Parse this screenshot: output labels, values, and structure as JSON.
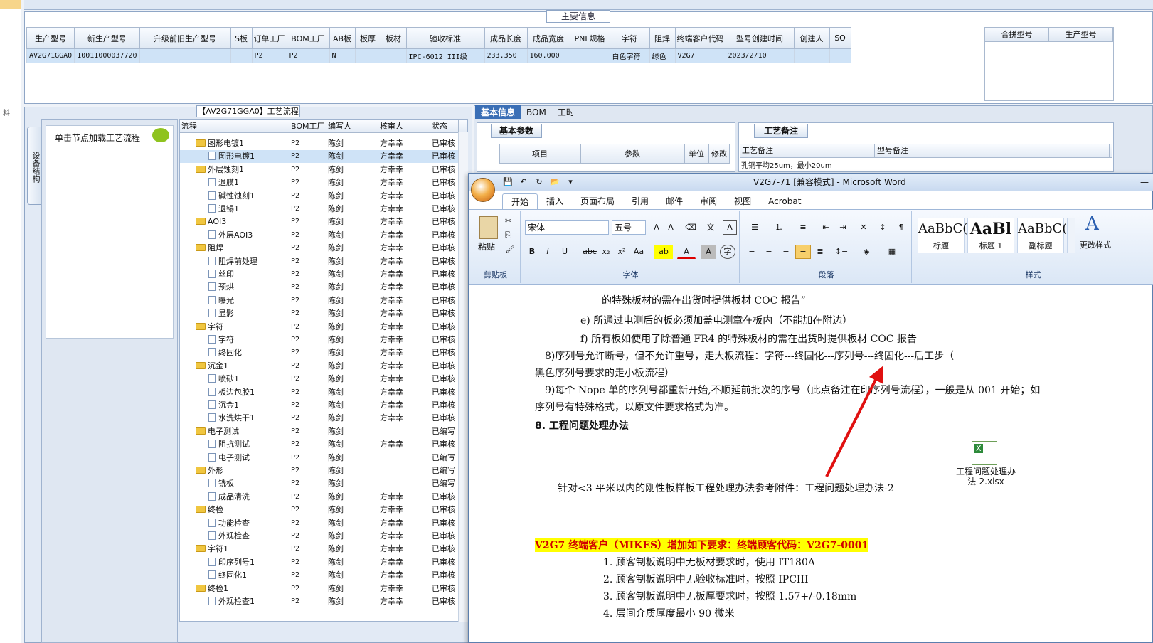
{
  "main_info": {
    "title": "主要信息",
    "columns": [
      "生产型号",
      "新生产型号",
      "升级前旧生产型号",
      "S板",
      "订单工厂",
      "BOM工厂",
      "AB板",
      "板厚",
      "板材",
      "验收标准",
      "成品长度",
      "成品宽度",
      "PNL规格",
      "字符",
      "阻焊",
      "终端客户代码",
      "型号创建时间",
      "创建人",
      "SO"
    ],
    "row": [
      "AV2G71GGA0",
      "10011000037720",
      "",
      "",
      "P2",
      "P2",
      "N",
      "",
      "",
      "IPC-6012 III级",
      "233.350",
      "160.000",
      "",
      "白色字符",
      "绿色",
      "V2G7",
      "2023/2/10",
      "",
      ""
    ],
    "merge_columns": [
      "合拼型号",
      "生产型号"
    ]
  },
  "left_panel": {
    "vertical_tab": "设备结构",
    "hint": "单击节点加载工艺流程"
  },
  "flow": {
    "title": "【AV2G71GGA0】工艺流程",
    "columns": [
      "流程",
      "BOM工厂",
      "编写人",
      "核审人",
      "状态"
    ],
    "rows": [
      {
        "name": "图形电镀1",
        "type": "folder",
        "indent": 1,
        "bom": "P2",
        "writer": "陈剑",
        "reviewer": "方幸幸",
        "status": "已审核"
      },
      {
        "name": "图形电镀1",
        "type": "doc",
        "indent": 2,
        "bom": "P2",
        "writer": "陈剑",
        "reviewer": "方幸幸",
        "status": "已审核"
      },
      {
        "name": "外层蚀刻1",
        "type": "folder",
        "indent": 1,
        "bom": "P2",
        "writer": "陈剑",
        "reviewer": "方幸幸",
        "status": "已审核"
      },
      {
        "name": "退膜1",
        "type": "doc",
        "indent": 2,
        "bom": "P2",
        "writer": "陈剑",
        "reviewer": "方幸幸",
        "status": "已审核"
      },
      {
        "name": "碱性蚀刻1",
        "type": "doc",
        "indent": 2,
        "bom": "P2",
        "writer": "陈剑",
        "reviewer": "方幸幸",
        "status": "已审核"
      },
      {
        "name": "退锡1",
        "type": "doc",
        "indent": 2,
        "bom": "P2",
        "writer": "陈剑",
        "reviewer": "方幸幸",
        "status": "已审核"
      },
      {
        "name": "AOI3",
        "type": "folder",
        "indent": 1,
        "bom": "P2",
        "writer": "陈剑",
        "reviewer": "方幸幸",
        "status": "已审核"
      },
      {
        "name": "外层AOI3",
        "type": "doc",
        "indent": 2,
        "bom": "P2",
        "writer": "陈剑",
        "reviewer": "方幸幸",
        "status": "已审核"
      },
      {
        "name": "阻焊",
        "type": "folder",
        "indent": 1,
        "bom": "P2",
        "writer": "陈剑",
        "reviewer": "方幸幸",
        "status": "已审核"
      },
      {
        "name": "阻焊前处理",
        "type": "doc",
        "indent": 2,
        "bom": "P2",
        "writer": "陈剑",
        "reviewer": "方幸幸",
        "status": "已审核"
      },
      {
        "name": "丝印",
        "type": "doc",
        "indent": 2,
        "bom": "P2",
        "writer": "陈剑",
        "reviewer": "方幸幸",
        "status": "已审核"
      },
      {
        "name": "预烘",
        "type": "doc",
        "indent": 2,
        "bom": "P2",
        "writer": "陈剑",
        "reviewer": "方幸幸",
        "status": "已审核"
      },
      {
        "name": "曝光",
        "type": "doc",
        "indent": 2,
        "bom": "P2",
        "writer": "陈剑",
        "reviewer": "方幸幸",
        "status": "已审核"
      },
      {
        "name": "显影",
        "type": "doc",
        "indent": 2,
        "bom": "P2",
        "writer": "陈剑",
        "reviewer": "方幸幸",
        "status": "已审核"
      },
      {
        "name": "字符",
        "type": "folder",
        "indent": 1,
        "bom": "P2",
        "writer": "陈剑",
        "reviewer": "方幸幸",
        "status": "已审核"
      },
      {
        "name": "字符",
        "type": "doc",
        "indent": 2,
        "bom": "P2",
        "writer": "陈剑",
        "reviewer": "方幸幸",
        "status": "已审核"
      },
      {
        "name": "终固化",
        "type": "doc",
        "indent": 2,
        "bom": "P2",
        "writer": "陈剑",
        "reviewer": "方幸幸",
        "status": "已审核"
      },
      {
        "name": "沉金1",
        "type": "folder",
        "indent": 1,
        "bom": "P2",
        "writer": "陈剑",
        "reviewer": "方幸幸",
        "status": "已审核"
      },
      {
        "name": "喷砂1",
        "type": "doc",
        "indent": 2,
        "bom": "P2",
        "writer": "陈剑",
        "reviewer": "方幸幸",
        "status": "已审核"
      },
      {
        "name": "板边包胶1",
        "type": "doc",
        "indent": 2,
        "bom": "P2",
        "writer": "陈剑",
        "reviewer": "方幸幸",
        "status": "已审核"
      },
      {
        "name": "沉金1",
        "type": "doc",
        "indent": 2,
        "bom": "P2",
        "writer": "陈剑",
        "reviewer": "方幸幸",
        "status": "已审核"
      },
      {
        "name": "水洗烘干1",
        "type": "doc",
        "indent": 2,
        "bom": "P2",
        "writer": "陈剑",
        "reviewer": "方幸幸",
        "status": "已审核"
      },
      {
        "name": "电子测试",
        "type": "folder",
        "indent": 1,
        "bom": "P2",
        "writer": "陈剑",
        "reviewer": "",
        "status": "已编写"
      },
      {
        "name": "阻抗测试",
        "type": "doc",
        "indent": 2,
        "bom": "P2",
        "writer": "陈剑",
        "reviewer": "方幸幸",
        "status": "已审核"
      },
      {
        "name": "电子测试",
        "type": "doc",
        "indent": 2,
        "bom": "P2",
        "writer": "陈剑",
        "reviewer": "",
        "status": "已编写"
      },
      {
        "name": "外形",
        "type": "folder",
        "indent": 1,
        "bom": "P2",
        "writer": "陈剑",
        "reviewer": "",
        "status": "已编写"
      },
      {
        "name": "铣板",
        "type": "doc",
        "indent": 2,
        "bom": "P2",
        "writer": "陈剑",
        "reviewer": "",
        "status": "已编写"
      },
      {
        "name": "成品清洗",
        "type": "doc",
        "indent": 2,
        "bom": "P2",
        "writer": "陈剑",
        "reviewer": "方幸幸",
        "status": "已审核"
      },
      {
        "name": "终检",
        "type": "folder",
        "indent": 1,
        "bom": "P2",
        "writer": "陈剑",
        "reviewer": "方幸幸",
        "status": "已审核"
      },
      {
        "name": "功能检查",
        "type": "doc",
        "indent": 2,
        "bom": "P2",
        "writer": "陈剑",
        "reviewer": "方幸幸",
        "status": "已审核"
      },
      {
        "name": "外观检查",
        "type": "doc",
        "indent": 2,
        "bom": "P2",
        "writer": "陈剑",
        "reviewer": "方幸幸",
        "status": "已审核"
      },
      {
        "name": "字符1",
        "type": "folder",
        "indent": 1,
        "bom": "P2",
        "writer": "陈剑",
        "reviewer": "方幸幸",
        "status": "已审核"
      },
      {
        "name": "印序列号1",
        "type": "doc",
        "indent": 2,
        "bom": "P2",
        "writer": "陈剑",
        "reviewer": "方幸幸",
        "status": "已审核"
      },
      {
        "name": "终固化1",
        "type": "doc",
        "indent": 2,
        "bom": "P2",
        "writer": "陈剑",
        "reviewer": "方幸幸",
        "status": "已审核"
      },
      {
        "name": "终检1",
        "type": "folder",
        "indent": 1,
        "bom": "P2",
        "writer": "陈剑",
        "reviewer": "方幸幸",
        "status": "已审核"
      },
      {
        "name": "外观检查1",
        "type": "doc",
        "indent": 2,
        "bom": "P2",
        "writer": "陈剑",
        "reviewer": "方幸幸",
        "status": "已审核"
      }
    ]
  },
  "right_tabs": [
    "基本信息",
    "BOM",
    "工时"
  ],
  "basic_params": {
    "tab": "基本参数",
    "columns": [
      "项目",
      "参数",
      "单位",
      "修改"
    ]
  },
  "proc_note": {
    "tab": "工艺备注",
    "columns": [
      "工艺备注",
      "型号备注"
    ],
    "row": "孔铜平均25um，最小20um"
  },
  "word": {
    "title": "V2G7-71 [兼容模式] - Microsoft Word",
    "tabs": [
      "开始",
      "插入",
      "页面布局",
      "引用",
      "邮件",
      "审阅",
      "视图",
      "Acrobat"
    ],
    "font_name": "宋体",
    "font_size": "五号",
    "groups": [
      "剪贴板",
      "字体",
      "段落",
      "样式"
    ],
    "paste_label": "粘贴",
    "styles": [
      {
        "sample": "AaBbC(",
        "name": "标题"
      },
      {
        "sample": "AaBl",
        "name": "标题 1"
      },
      {
        "sample": "AaBbC(",
        "name": "副标题"
      }
    ],
    "change_styles": "更改样式",
    "lines": [
      "的特殊板材的需在出货时提供板材 COC 报告”",
      "e)  所通过电测后的板必须加盖电测章在板内（不能加在附边）",
      "f)  所有板如使用了除普通 FR4 的特殊板材的需在出货时提供板材 COC 报告",
      "8)序列号允许断号，但不允许重号，走大板流程：字符---终固化---序列号---终固化---后工步（",
      "黑色序列号要求的走小板流程）",
      "9)每个 Nope 单的序列号都重新开始,不顺延前批次的序号（此点备注在印序列号流程），一般是从 001 开始；如",
      "序列号有特殊格式，以原文件要求格式为准。",
      "8. 工程问题处理办法",
      "针对<3 平米以内的刚性板样板工程处理办法参考附件：工程问题处理办法-2",
      "V2G7 终端客户（MIKES）增加如下要求：终端顾客代码：V2G7-0001",
      "1.    顾客制板说明中无板材要求时，使用 IT180A",
      "2.    顾客制板说明中无验收标准时，按照 IPCIII",
      "3.    顾客制板说明中无板厚要求时，按照 1.57+/-0.18mm",
      "4.    层间介质厚度最小 90 微米"
    ],
    "attachment": "工程问题处理办法-2.xlsx",
    "arrow_color": "#e01010"
  }
}
